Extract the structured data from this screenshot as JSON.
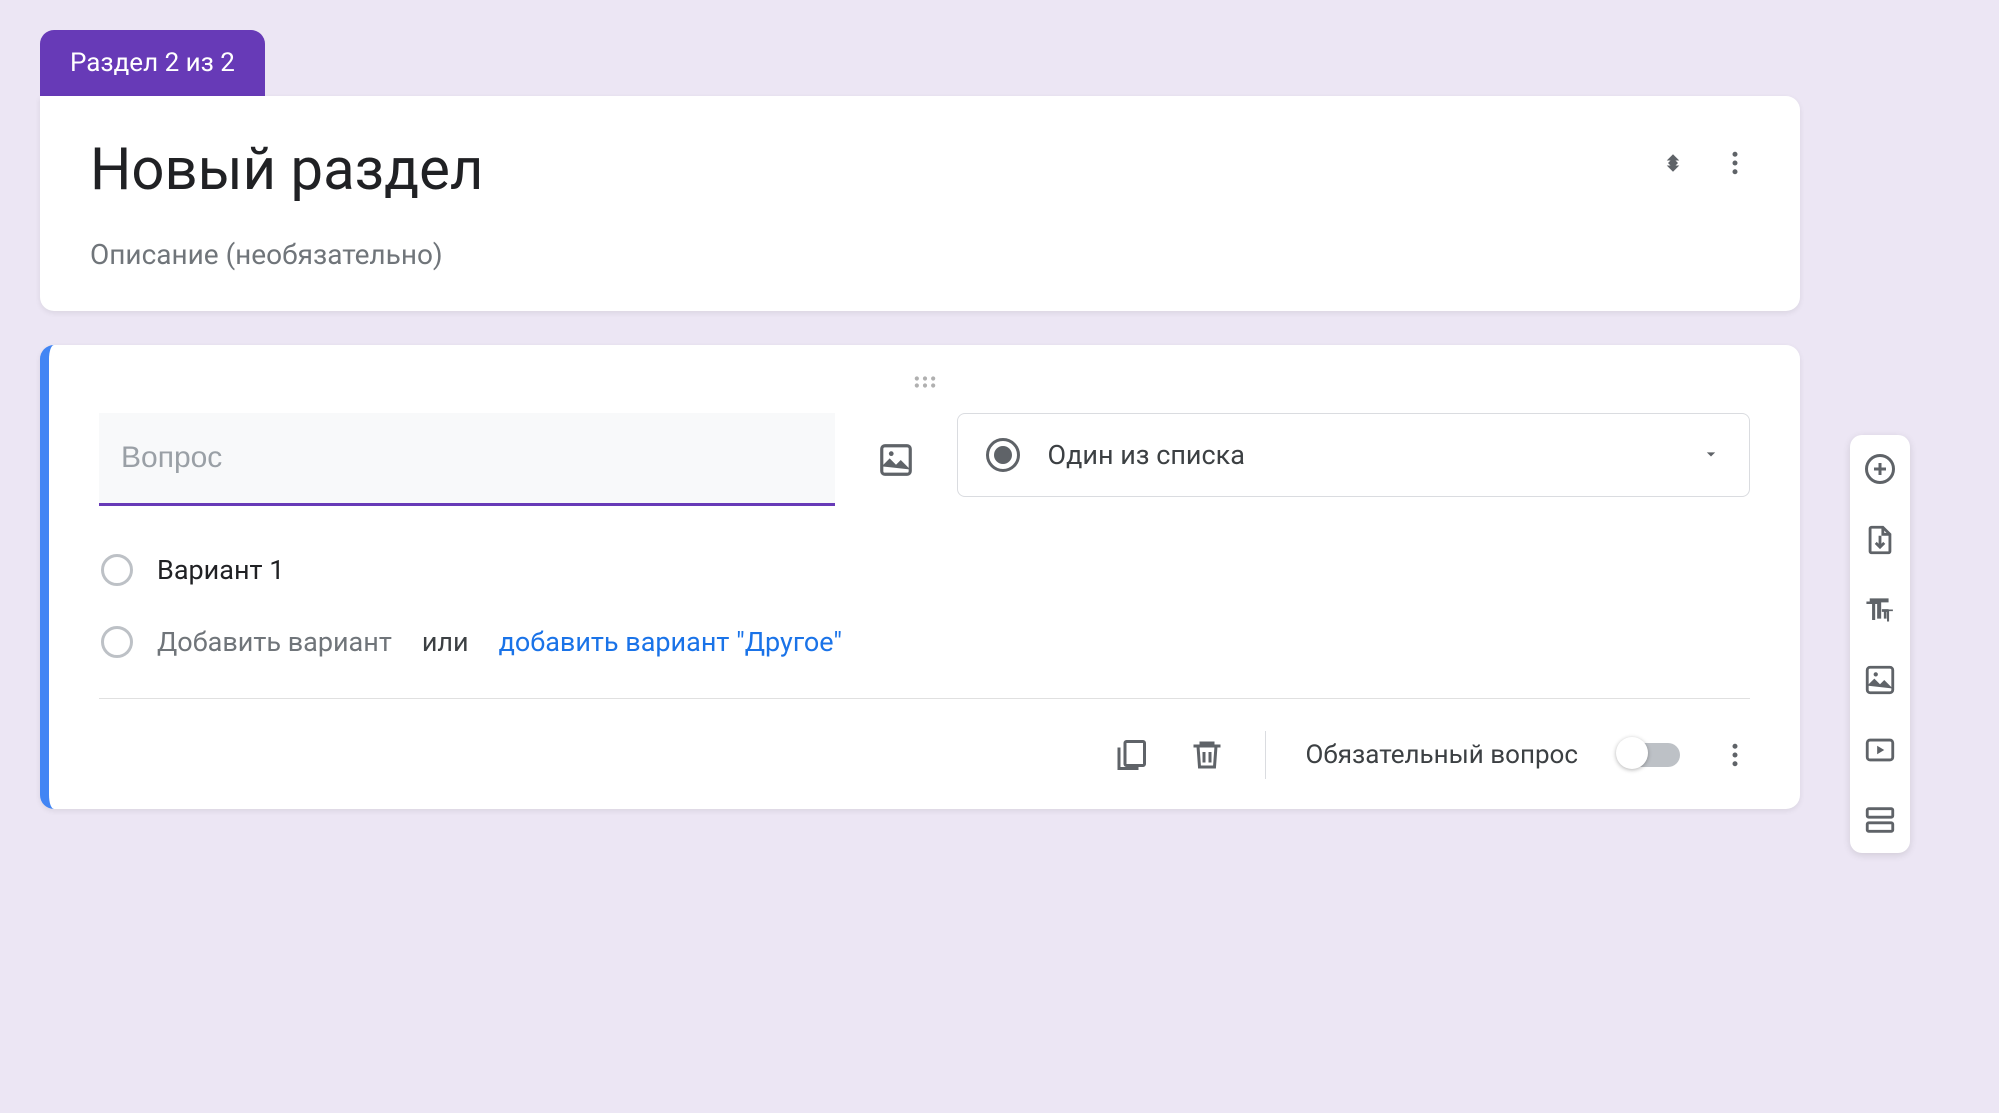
{
  "section": {
    "badge": "Раздел 2 из 2",
    "title": "Новый раздел",
    "description_placeholder": "Описание (необязательно)"
  },
  "question": {
    "placeholder": "Вопрос",
    "type_label": "Один из списка",
    "option1": "Вариант 1",
    "add_option": "Добавить вариант",
    "or": "или",
    "add_other": "добавить вариант \"Другое\"",
    "required_label": "Обязательный вопрос"
  },
  "icons": {
    "collapse": "collapse",
    "more": "more-vert",
    "image": "image",
    "caret": "arrow-drop-down",
    "copy": "copy",
    "delete": "delete",
    "add_circle": "add-circle",
    "import": "import-file",
    "title_text": "title",
    "add_image": "image",
    "add_video": "video",
    "add_section": "section"
  }
}
